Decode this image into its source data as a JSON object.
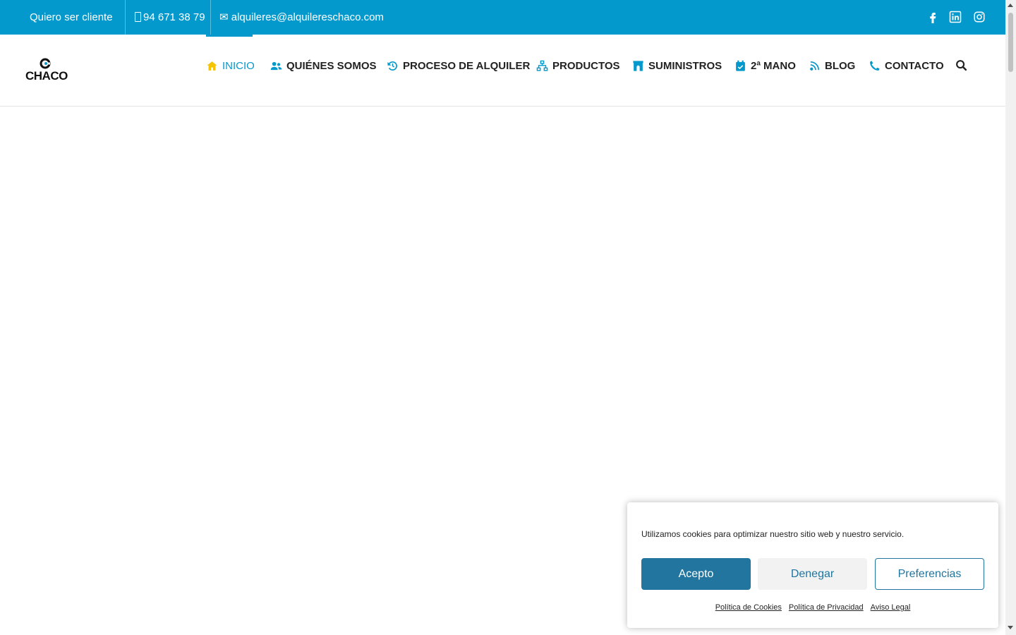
{
  "topbar": {
    "client_link": "Quiero ser cliente",
    "phone_icon": "",
    "phone": "94 671 38 79",
    "email_icon": "✉",
    "email": "alquileres@alquilereschaco.com",
    "social": [
      "facebook-icon",
      "linkedin-icon",
      "instagram-icon"
    ]
  },
  "logo": {
    "text": "CHACO"
  },
  "nav": {
    "items": [
      {
        "label": "INICIO",
        "icon": "home-icon",
        "active": true
      },
      {
        "label": "QUIÉNES SOMOS",
        "icon": "users-icon"
      },
      {
        "label": "PROCESO DE ALQUILER",
        "icon": "history-icon"
      },
      {
        "label": "PRODUCTOS",
        "icon": "sitemap-icon"
      },
      {
        "label": "SUMINISTROS",
        "icon": "archway-icon"
      },
      {
        "label": "2ª MANO",
        "icon": "calendar-check-icon"
      },
      {
        "label": "BLOG",
        "icon": "blog-icon"
      },
      {
        "label": "CONTACTO",
        "icon": "phone-icon"
      }
    ],
    "search_icon": "search-icon"
  },
  "cookie": {
    "message": "Utilizamos cookies para optimizar nuestro sitio web y nuestro servicio.",
    "accept": "Acepto",
    "deny": "Denegar",
    "preferences": "Preferencias",
    "links": [
      "Política de Cookies",
      "Política de Privacidad",
      "Aviso Legal"
    ]
  },
  "colors": {
    "brand": "#0499cc",
    "nav_active_icon": "#f5c400",
    "button_blue": "#21759e"
  }
}
